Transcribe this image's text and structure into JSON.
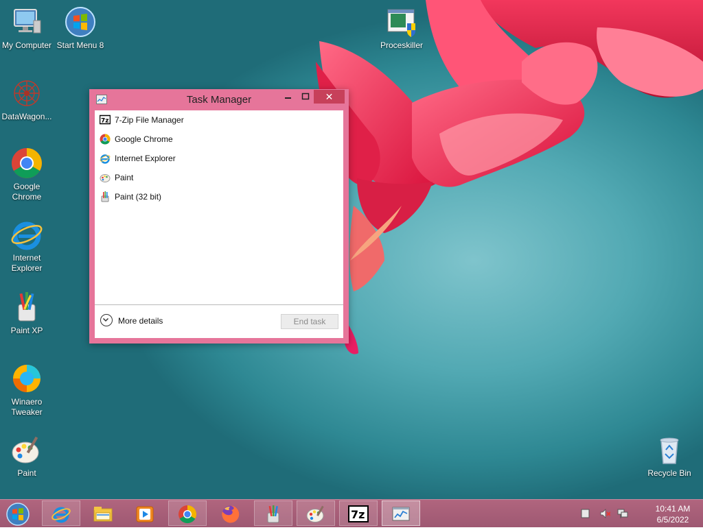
{
  "desktop": {
    "icons": [
      {
        "label": "My Computer",
        "icon": "computer-icon"
      },
      {
        "label": "Start Menu 8",
        "icon": "start-orb-icon"
      },
      {
        "label": "Proceskiller",
        "icon": "proceskiller-icon"
      },
      {
        "label": "DataWagon...",
        "icon": "datawagon-icon"
      },
      {
        "label": "Google\nChrome",
        "icon": "chrome-icon"
      },
      {
        "label": "Internet\nExplorer",
        "icon": "ie-icon"
      },
      {
        "label": "Paint XP",
        "icon": "paint-xp-icon"
      },
      {
        "label": "Winaero\nTweaker",
        "icon": "winaero-tweaker-icon"
      },
      {
        "label": "Paint",
        "icon": "paint-palette-icon"
      },
      {
        "label": "Recycle Bin",
        "icon": "recycle-bin-icon"
      }
    ]
  },
  "task_manager": {
    "title": "Task Manager",
    "close_glyph": "✕",
    "processes": [
      {
        "name": "7-Zip File Manager",
        "icon": "7zip-icon"
      },
      {
        "name": "Google Chrome",
        "icon": "chrome-icon"
      },
      {
        "name": "Internet Explorer",
        "icon": "ie-icon"
      },
      {
        "name": "Paint",
        "icon": "paint-palette-icon"
      },
      {
        "name": "Paint (32 bit)",
        "icon": "paint-brush-icon"
      }
    ],
    "more_details": "More details",
    "end_task": "End task",
    "accent": "#e6759a"
  },
  "taskbar": {
    "buttons": [
      {
        "icon": "ie-icon"
      },
      {
        "icon": "file-explorer-icon"
      },
      {
        "icon": "media-player-icon"
      },
      {
        "icon": "chrome-icon"
      },
      {
        "icon": "firefox-icon"
      },
      {
        "icon": "paint-brush-icon"
      },
      {
        "icon": "paint-palette-icon"
      },
      {
        "icon": "7zip-icon"
      },
      {
        "icon": "task-manager-icon",
        "active": true
      }
    ],
    "tray": [
      "show-desktop-icon",
      "volume-muted-icon",
      "network-icon"
    ],
    "clock_time": "10:41 AM",
    "clock_date": "6/5/2022",
    "color": "#a85e78"
  }
}
